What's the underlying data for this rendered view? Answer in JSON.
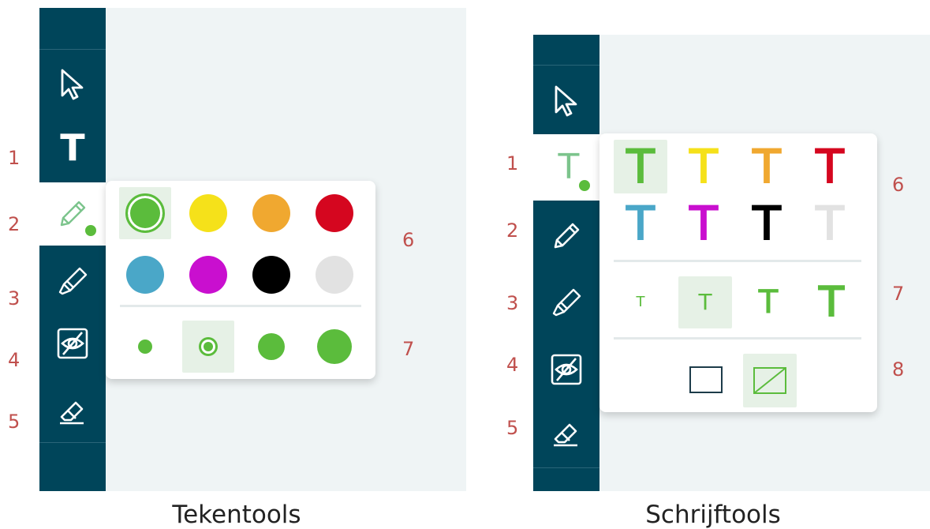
{
  "left": {
    "caption": "Tekentools",
    "active_tool": "pencil",
    "numbers": [
      "1",
      "2",
      "3",
      "4",
      "5",
      "6",
      "7"
    ],
    "colors": [
      "#5bbc3c",
      "#f5e11a",
      "#f0a830",
      "#d5061f",
      "#4aa7c8",
      "#c90fcf",
      "#000000",
      "#e2e2e2"
    ],
    "selected_color": "#5bbc3c",
    "brush_sizes": [
      "small",
      "medium",
      "large",
      "extra-large"
    ],
    "selected_size": "medium"
  },
  "right": {
    "caption": "Schrijftools",
    "active_tool": "text",
    "numbers": [
      "1",
      "2",
      "3",
      "4",
      "5",
      "6",
      "7",
      "8"
    ],
    "text_glyph": "T",
    "colors": [
      "#5bbc3c",
      "#f5e11a",
      "#f0a830",
      "#d5061f",
      "#4aa7c8",
      "#c90fcf",
      "#000000",
      "#e2e2e2"
    ],
    "selected_color": "#5bbc3c",
    "text_sizes": [
      "small",
      "medium",
      "large",
      "extra-large"
    ],
    "selected_size": "medium",
    "background_options": [
      "box",
      "no-box"
    ],
    "selected_background": "no-box"
  }
}
